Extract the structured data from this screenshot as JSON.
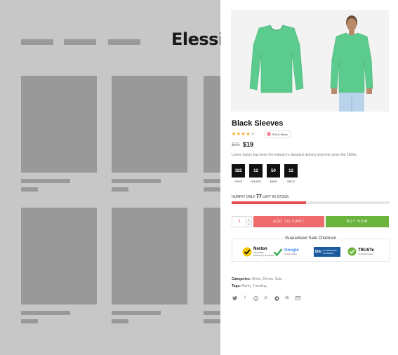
{
  "background": {
    "logo_text": "Elessi",
    "logo_dot": ".",
    "logo_dot_color": "#e8403c"
  },
  "product": {
    "title": "Black Sleeves",
    "rating": {
      "stars": 4,
      "max": 5
    },
    "variant_label": "Pull & Shirts",
    "old_price": "$21",
    "price": "$19",
    "description": "Lorem Ipsum has been the industry's standard dummy text ever since the 1500s.",
    "sweater_color": "#5ccb8e"
  },
  "countdown": [
    {
      "value": "182",
      "label": "DAYS"
    },
    {
      "value": "12",
      "label": "HOURS"
    },
    {
      "value": "50",
      "label": "MINS"
    },
    {
      "value": "12",
      "label": "SECS"
    }
  ],
  "stock": {
    "prefix": "HURRY! ONLY",
    "count": "77",
    "suffix": "LEFT IN STOCK.",
    "progress_percent": 47,
    "progress_color": "#e34d4d"
  },
  "purchase": {
    "quantity": "1",
    "add_to_cart_label": "ADD TO CART",
    "buy_now_label": "BUY NOW",
    "cart_color": "#ee6b6b",
    "buy_color": "#6ab33d"
  },
  "checkout": {
    "title": "Guaranteed Safe Checkout",
    "badges": {
      "norton": {
        "title": "Norton",
        "sub": "SECURED",
        "sub2": "powered by Symantec"
      },
      "google": {
        "title": "Google",
        "sub": "Trusted Store"
      },
      "bbb": {
        "title": "ACCREDITED",
        "sub": "BUSINESS"
      },
      "truste": {
        "title": "TRUSTe",
        "sub": "Certified Privacy"
      }
    }
  },
  "meta": {
    "categories_label": "Categories:",
    "categories": [
      "Shirts",
      "Denim",
      "Sale"
    ],
    "tags_label": "Tags:",
    "tags": [
      "Menly",
      "Trending"
    ]
  },
  "social_icons": [
    "twitter-icon",
    "facebook-icon",
    "pinterest-icon",
    "linkedin-icon",
    "telegram-icon",
    "vk-icon",
    "email-icon"
  ]
}
